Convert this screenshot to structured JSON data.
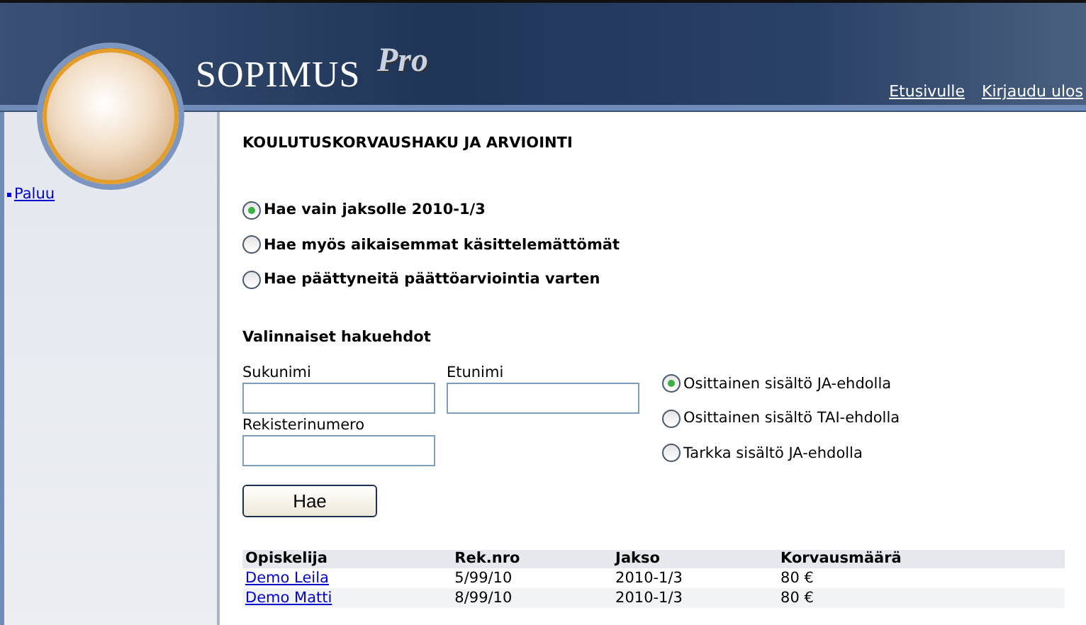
{
  "header": {
    "logo_text": "SOPIMUS",
    "logo_suffix": "Pro",
    "links": [
      {
        "label": "Etusivulle"
      },
      {
        "label": "Kirjaudu ulos"
      }
    ]
  },
  "sidebar": {
    "items": [
      {
        "label": "Paluu"
      }
    ]
  },
  "page_title": "KOULUTUSKORVAUSHAKU JA ARVIOINTI",
  "period_options": [
    {
      "label": "Hae vain jaksolle 2010-1/3",
      "selected": true
    },
    {
      "label": "Hae myös aikaisemmat käsittelemättömät",
      "selected": false
    },
    {
      "label": "Hae päättyneitä päättöarviointia varten",
      "selected": false
    }
  ],
  "optional_title": "Valinnaiset hakuehdot",
  "fields": {
    "surname": {
      "label": "Sukunimi"
    },
    "first_name": {
      "label": "Etunimi"
    },
    "reg_number": {
      "label": "Rekisterinumero"
    }
  },
  "match_options": [
    {
      "label": "Osittainen sisältö JA-ehdolla",
      "selected": true
    },
    {
      "label": "Osittainen sisältö TAI-ehdolla",
      "selected": false
    },
    {
      "label": "Tarkka sisältö JA-ehdolla",
      "selected": false
    }
  ],
  "search_button": "Hae",
  "table": {
    "columns": [
      "Opiskelija",
      "Rek.nro",
      "Jakso",
      "Korvausmäärä"
    ],
    "rows": [
      [
        "Demo Leila",
        "5/99/10",
        "2010-1/3",
        "80 €"
      ],
      [
        "Demo Matti",
        "8/99/10",
        "2010-1/3",
        "80 €"
      ]
    ]
  }
}
